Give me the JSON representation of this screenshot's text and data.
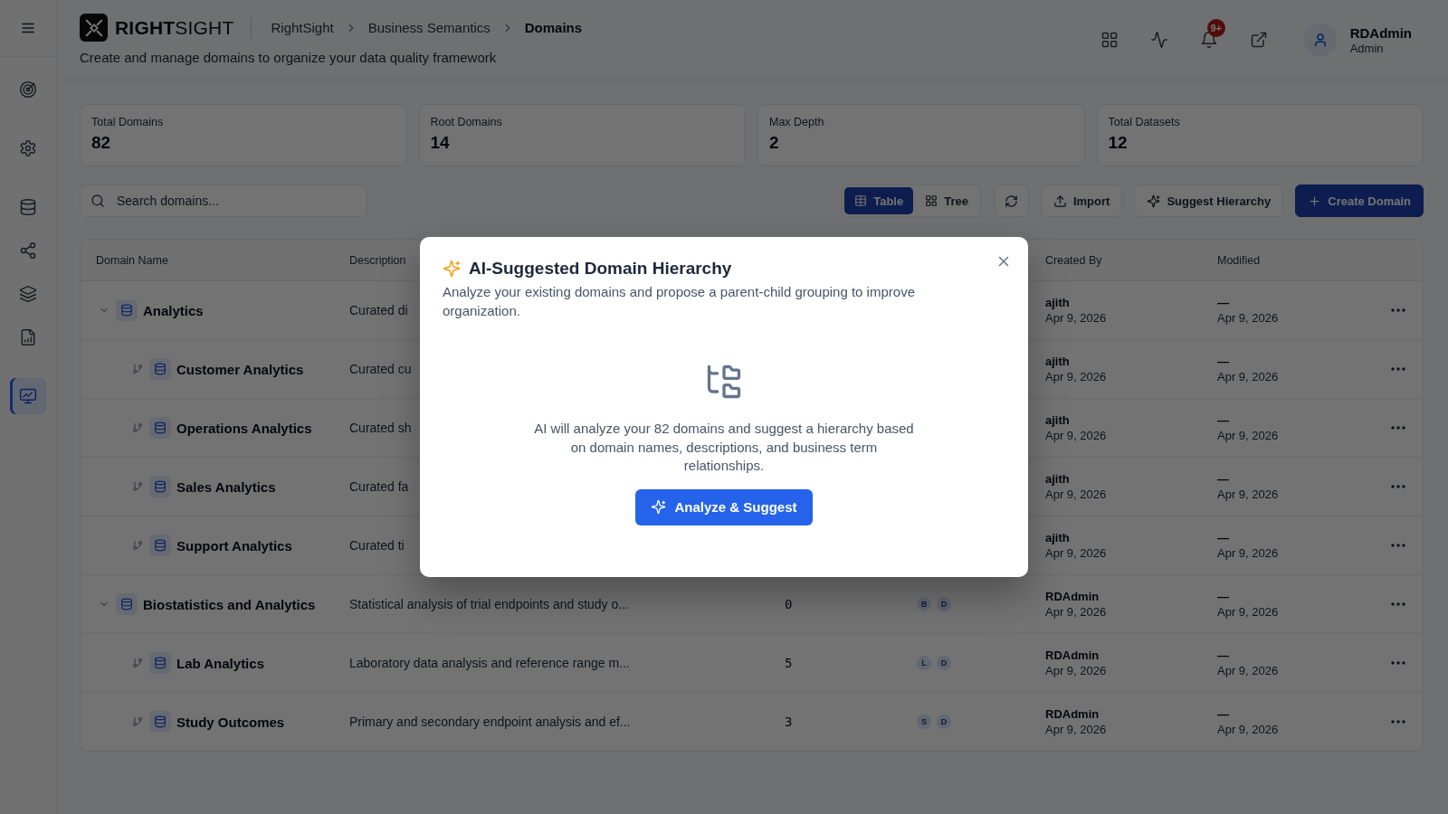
{
  "sidebar": {
    "items": [
      {
        "selected": false
      },
      {
        "selected": false
      },
      {
        "selected": false
      },
      {
        "selected": false
      },
      {
        "selected": false
      },
      {
        "selected": false
      },
      {
        "selected": true
      }
    ]
  },
  "header": {
    "logo_text": "**RIGHT**SIGHT",
    "breadcrumbs": [
      {
        "label": "RightSight",
        "current": false
      },
      {
        "label": "Business Semantics",
        "current": false
      },
      {
        "label": "Domains",
        "current": true
      }
    ],
    "subtitle": "Create and manage domains to organize your data quality framework",
    "notification_count": "9+",
    "user": {
      "name": "RDAdmin",
      "role": "Admin"
    }
  },
  "stats": [
    {
      "label": "Total Domains",
      "value": "82"
    },
    {
      "label": "Root Domains",
      "value": "14"
    },
    {
      "label": "Max Depth",
      "value": "2"
    },
    {
      "label": "Total Datasets",
      "value": "12"
    }
  ],
  "toolbar": {
    "search": {
      "placeholder": "Search domains..."
    },
    "view_tabs": [
      {
        "label": "Table",
        "selected": true
      },
      {
        "label": "Tree",
        "selected": false
      }
    ],
    "actions": [
      {
        "kind": "icon"
      },
      {
        "kind": "outline",
        "label": "Import"
      },
      {
        "kind": "outline",
        "label": "Suggest Hierarchy"
      },
      {
        "kind": "primary",
        "label": "Create Domain"
      }
    ]
  },
  "table": {
    "columns": [
      "Domain Name",
      "Description",
      "Created By",
      "Modified"
    ],
    "rows": [
      {
        "name": "Analytics",
        "description": "Curated di",
        "created_by": "ajith",
        "created_date": "Apr 9, 2026",
        "modified_by": "—",
        "modified_date": "Apr 9, 2026",
        "expanded": true,
        "children": [
          {
            "name": "Customer Analytics",
            "description": "Curated cu",
            "created_by": "ajith",
            "created_date": "Apr 9, 2026",
            "modified_by": "—",
            "modified_date": "Apr 9, 2026"
          },
          {
            "name": "Operations Analytics",
            "description": "Curated sh",
            "created_by": "ajith",
            "created_date": "Apr 9, 2026",
            "modified_by": "—",
            "modified_date": "Apr 9, 2026"
          },
          {
            "name": "Sales Analytics",
            "description": "Curated fa",
            "created_by": "ajith",
            "created_date": "Apr 9, 2026",
            "modified_by": "—",
            "modified_date": "Apr 9, 2026"
          },
          {
            "name": "Support Analytics",
            "description": "Curated ti",
            "created_by": "ajith",
            "created_date": "Apr 9, 2026",
            "modified_by": "—",
            "modified_date": "Apr 9, 2026"
          }
        ]
      },
      {
        "name": "Biostatistics and Analytics",
        "description": "Statistical analysis of trial endpoints and study o...",
        "column_3": "0",
        "column_4": [
          "B",
          "D"
        ],
        "created_by": "RDAdmin",
        "created_date": "Apr 9, 2026",
        "modified_by": "—",
        "modified_date": "Apr 9, 2026",
        "expanded": true,
        "children": [
          {
            "name": "Lab Analytics",
            "description": "Laboratory data analysis and reference range m...",
            "column_3": "5",
            "column_4": [
              "L",
              "D"
            ],
            "created_by": "RDAdmin",
            "created_date": "Apr 9, 2026",
            "modified_by": "—",
            "modified_date": "Apr 9, 2026"
          },
          {
            "name": "Study Outcomes",
            "description": "Primary and secondary endpoint analysis and ef...",
            "column_3": "3",
            "column_4": [
              "S",
              "D"
            ],
            "created_by": "RDAdmin",
            "created_date": "Apr 9, 2026",
            "modified_by": "—",
            "modified_date": "Apr 9, 2026"
          }
        ]
      }
    ]
  },
  "modal": {
    "title": "AI-Suggested Domain Hierarchy",
    "description": "Analyze your existing domains and propose a parent-child grouping to improve organization.",
    "body": "AI will analyze your 82 domains and suggest a hierarchy based on domain names, descriptions, and business term relationships.",
    "button": "Analyze & Suggest"
  }
}
